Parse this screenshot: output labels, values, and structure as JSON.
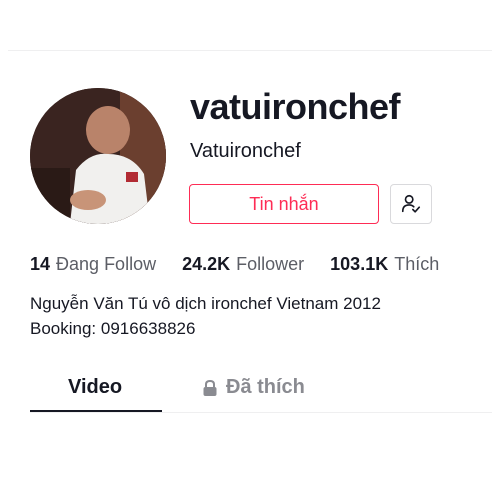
{
  "profile": {
    "username": "vatuironchef",
    "nickname": "Vatuironchef",
    "avatar_icon": "chef-avatar"
  },
  "actions": {
    "message_label": "Tin nhắn",
    "follow_icon": "user-check-icon"
  },
  "stats": [
    {
      "value": "14",
      "label": "Đang Follow"
    },
    {
      "value": "24.2K",
      "label": "Follower"
    },
    {
      "value": "103.1K",
      "label": "Thích"
    }
  ],
  "bio": {
    "line1": "Nguyễn Văn Tú vô dịch ironchef Vietnam 2012",
    "line2": "Booking: 0916638826"
  },
  "tabs": [
    {
      "label": "Video",
      "active": true
    },
    {
      "label": "Đã thích",
      "active": false,
      "icon": "lock-icon"
    }
  ],
  "colors": {
    "accent": "#fe2c55",
    "text": "#161823",
    "muted": "#5c5e66"
  }
}
